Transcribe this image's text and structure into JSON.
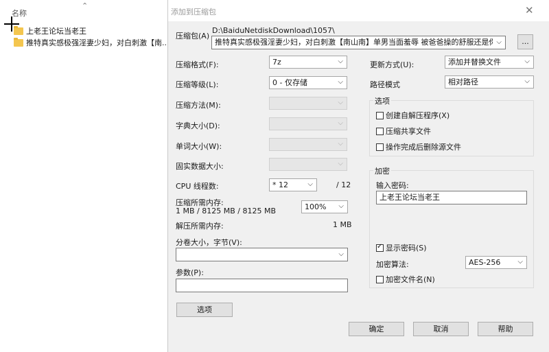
{
  "explorer": {
    "column_header": "名称",
    "sort_icon": "chevron-up",
    "files": [
      {
        "name": "上老王论坛当老王",
        "icon": "folder-icon"
      },
      {
        "name": "推特真实感极强淫妻少妇，对白刺激【南...",
        "icon": "folder-icon"
      }
    ]
  },
  "dialog": {
    "title": "添加到压缩包",
    "archive_label": "压缩包(A)",
    "archive_path": "D:\\BaiduNetdiskDownload\\1057\\",
    "archive_name": "推特真实感极强淫妻少妇，对白刺激【南山南】单男当面羞辱 被爸爸操的舒服还是你老公",
    "browse_label": "...",
    "format_label": "压缩格式(F):",
    "format_value": "7z",
    "level_label": "压缩等级(L):",
    "level_value": "0 - 仅存储",
    "method_label": "压缩方法(M):",
    "dict_label": "字典大小(D):",
    "word_label": "单词大小(W):",
    "solid_label": "固实数据大小:",
    "cpu_label": "CPU 线程数:",
    "cpu_value": "* 12",
    "cpu_max": "/ 12",
    "mem_compress_label": "压缩所需内存:",
    "mem_compress_value": "1 MB / 8125 MB / 8125 MB",
    "mem_percent": "100%",
    "mem_decompress_label": "解压所需内存:",
    "mem_decompress_value": "1 MB",
    "split_label": "分卷大小，字节(V):",
    "split_value": "",
    "params_label": "参数(P):",
    "params_value": "",
    "options_button": "选项",
    "update_label": "更新方式(U):",
    "update_value": "添加并替换文件",
    "path_label": "路径模式",
    "path_value": "相对路径",
    "options_group": "选项",
    "opt_sfx": "创建自解压程序(X)",
    "opt_sfx_checked": false,
    "opt_shared": "压缩共享文件",
    "opt_shared_checked": false,
    "opt_delete": "操作完成后删除源文件",
    "opt_delete_checked": false,
    "encrypt_group": "加密",
    "password_label": "输入密码:",
    "password_value": "上老王论坛当老王",
    "show_password": "显示密码(S)",
    "show_password_checked": true,
    "enc_method_label": "加密算法:",
    "enc_method_value": "AES-256",
    "encrypt_names": "加密文件名(N)",
    "encrypt_names_checked": false,
    "ok": "确定",
    "cancel": "取消",
    "help": "帮助"
  }
}
